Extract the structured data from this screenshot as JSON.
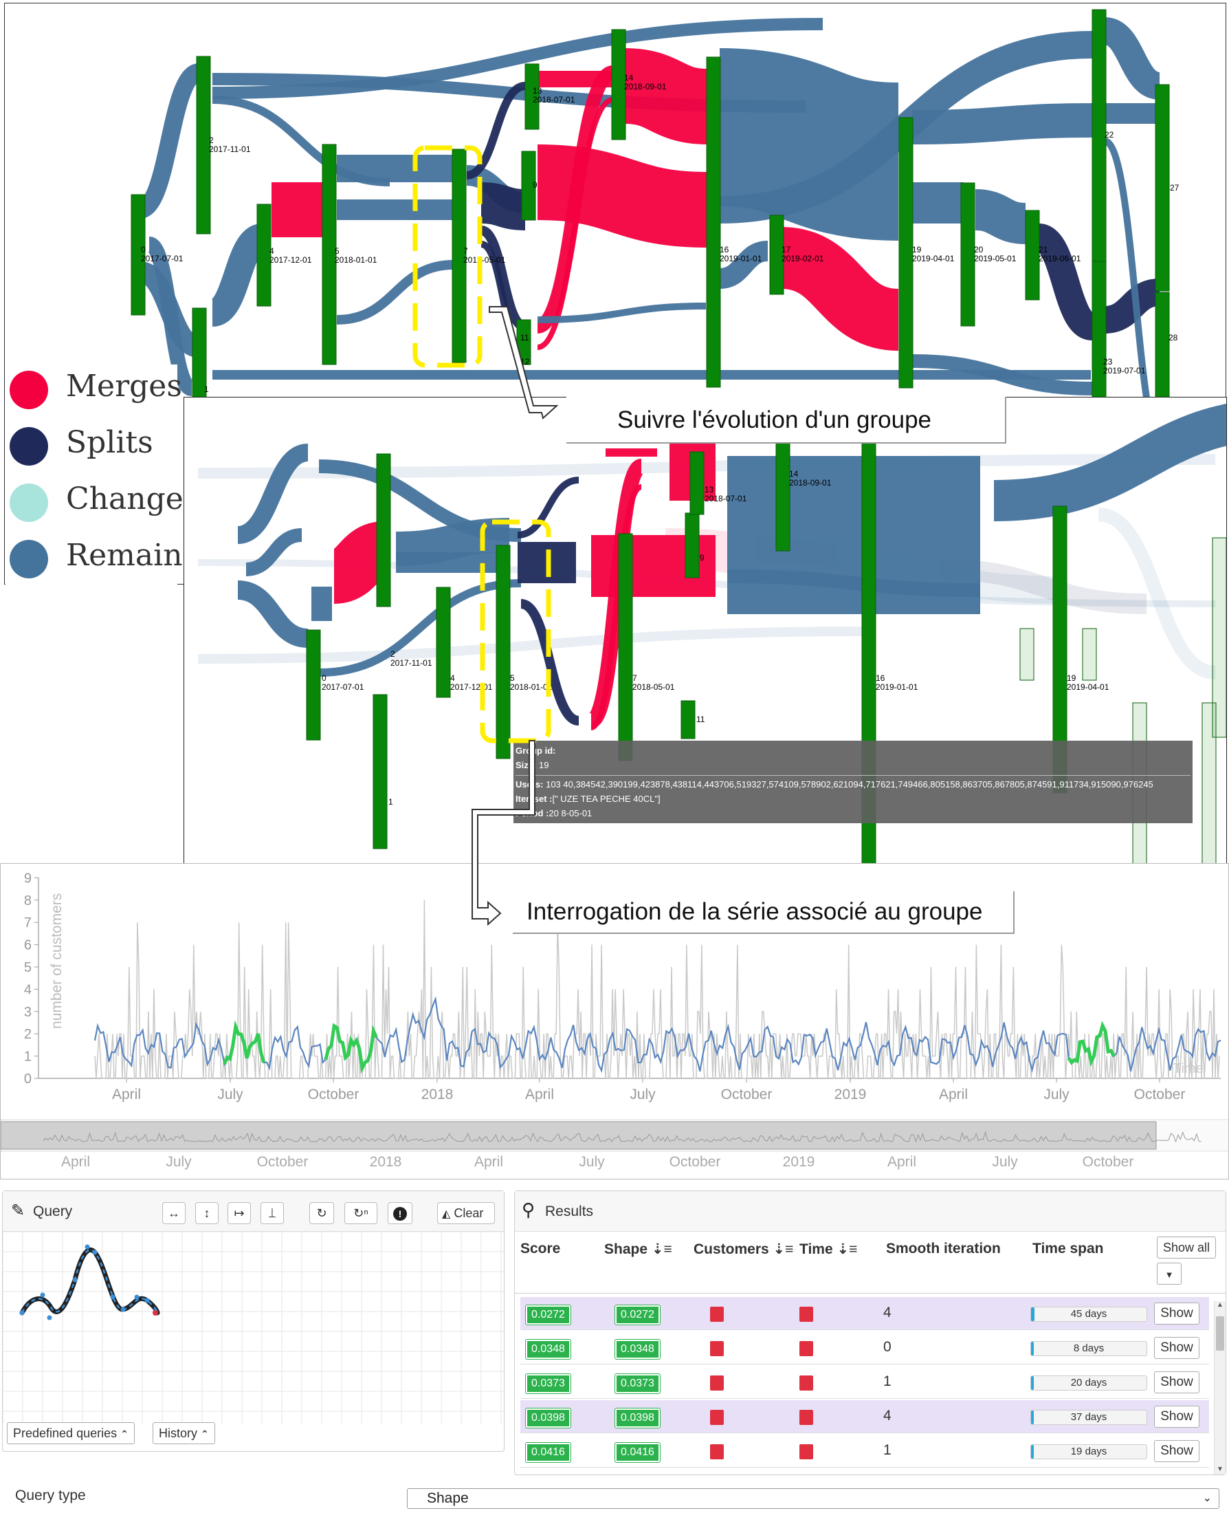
{
  "colors": {
    "merge": "#f40040",
    "split": "#1f2a5b",
    "change": "#a8e3dc",
    "remains": "#44739c",
    "node": "#098709",
    "highlight": "#ffee00",
    "raw_series": "#c8c8c8",
    "smooth_series": "#5b86c0",
    "match": "#33cc55",
    "badge": "#2bb24c",
    "marker": "#e03040"
  },
  "legend": [
    {
      "label": "Merges",
      "color": "#f40040"
    },
    {
      "label": "Splits",
      "color": "#1f2a5b"
    },
    {
      "label": "Changes",
      "color": "#a8e3dc"
    },
    {
      "label": "Remains",
      "color": "#44739c"
    }
  ],
  "callouts": {
    "evolution": "Suivre l'évolution d'un groupe",
    "query": "Interrogation de la série associé au groupe"
  },
  "sankey_top": {
    "nodes": [
      {
        "id": "0",
        "date": "2017-07-01"
      },
      {
        "id": "1",
        "date": ""
      },
      {
        "id": "2",
        "date": "2017-11-01"
      },
      {
        "id": "4",
        "date": "2017-12-01"
      },
      {
        "id": "5",
        "date": "2018-01-01"
      },
      {
        "id": "7",
        "date": "2018-05-01"
      },
      {
        "id": "9",
        "date": ""
      },
      {
        "id": "11",
        "date": ""
      },
      {
        "id": "12",
        "date": ""
      },
      {
        "id": "13",
        "date": "2018-07-01"
      },
      {
        "id": "14",
        "date": "2018-09-01"
      },
      {
        "id": "16",
        "date": "2019-01-01"
      },
      {
        "id": "17",
        "date": "2019-02-01"
      },
      {
        "id": "19",
        "date": "2019-04-01"
      },
      {
        "id": "20",
        "date": "2019-05-01"
      },
      {
        "id": "21",
        "date": "2019-06-01"
      },
      {
        "id": "22",
        "date": ""
      },
      {
        "id": "23",
        "date": "2019-07-01"
      },
      {
        "id": "27",
        "date": ""
      },
      {
        "id": "28",
        "date": ""
      }
    ]
  },
  "sankey_bottom": {
    "nodes": [
      {
        "id": "0",
        "date": "2017-07-01"
      },
      {
        "id": "1",
        "date": ""
      },
      {
        "id": "2",
        "date": "2017-11-01"
      },
      {
        "id": "4",
        "date": "2017-12-01"
      },
      {
        "id": "5",
        "date": "2018-01-01"
      },
      {
        "id": "7",
        "date": "2018-05-01"
      },
      {
        "id": "9",
        "date": ""
      },
      {
        "id": "11",
        "date": ""
      },
      {
        "id": "13",
        "date": "2018-07-01"
      },
      {
        "id": "14",
        "date": "2018-09-01"
      },
      {
        "id": "16",
        "date": "2019-01-01"
      },
      {
        "id": "19",
        "date": "2019-04-01"
      },
      {
        "id": "22",
        "date": ""
      }
    ]
  },
  "tooltip": {
    "group_label": "Group id:",
    "size_label": "Size:",
    "size_value": "19",
    "users_label": "Users:",
    "users_value": "103 40,384542,390199,423878,438114,443706,519327,574109,578902,621094,717621,749466,805158,863705,867805,874591,911734,915090,976245",
    "itemset_label": "Itemset :",
    "itemset_value": "[\" UZE TEA PECHE 40CL\"]",
    "period_label": "Period :",
    "period_value": "20 8-05-01"
  },
  "timeseries": {
    "ylabel": "number of customers",
    "y_ticks": [
      "0",
      "1",
      "2",
      "3",
      "4",
      "5",
      "6",
      "7",
      "8",
      "9"
    ],
    "x_ticks": [
      "April",
      "July",
      "October",
      "2018",
      "April",
      "July",
      "October",
      "2019",
      "April",
      "July",
      "October"
    ],
    "corner_label": "Time",
    "nav_ticks": [
      "April",
      "July",
      "October",
      "2018",
      "April",
      "July",
      "October",
      "2019",
      "April",
      "July",
      "October"
    ]
  },
  "query": {
    "title": "Query",
    "tools": [
      "↔",
      "↕",
      "↦",
      "⟘",
      "↻",
      "↻ⁿ",
      "!"
    ],
    "clear_label": "Clear",
    "predefined_label": "Predefined queries",
    "history_label": "History"
  },
  "results": {
    "title": "Results",
    "columns": [
      "Score",
      "Shape",
      "Customers",
      "Time",
      "Smooth iteration",
      "Time span"
    ],
    "show_all_label": "Show all",
    "rows": [
      {
        "score": "0.0272",
        "shape": "0.0272",
        "smooth": "4",
        "span": "45 days",
        "span_frac": 0.03,
        "highlight": true
      },
      {
        "score": "0.0348",
        "shape": "0.0348",
        "smooth": "0",
        "span": "8 days",
        "span_frac": 0.006,
        "highlight": false
      },
      {
        "score": "0.0373",
        "shape": "0.0373",
        "smooth": "1",
        "span": "20 days",
        "span_frac": 0.014,
        "highlight": false
      },
      {
        "score": "0.0398",
        "shape": "0.0398",
        "smooth": "4",
        "span": "37 days",
        "span_frac": 0.026,
        "highlight": true
      },
      {
        "score": "0.0416",
        "shape": "0.0416",
        "smooth": "1",
        "span": "19 days",
        "span_frac": 0.013,
        "highlight": false
      }
    ],
    "show_label": "Show"
  },
  "query_type": {
    "label": "Query type",
    "value": "Shape"
  }
}
